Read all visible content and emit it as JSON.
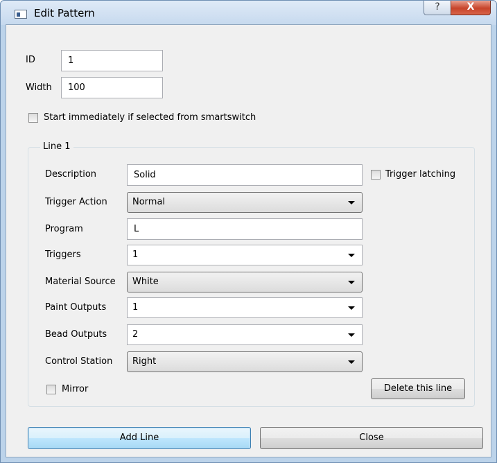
{
  "window": {
    "title": "Edit Pattern",
    "help_glyph": "?",
    "close_glyph": "X"
  },
  "form": {
    "id_label": "ID",
    "id_value": "1",
    "width_label": "Width",
    "width_value": "100",
    "start_immediately_label": "Start immediately if selected from smartswitch",
    "start_immediately_checked": false
  },
  "line_group": {
    "title": "Line 1",
    "description_label": "Description",
    "description_value": "Solid",
    "trigger_latching_label": "Trigger latching",
    "trigger_latching_checked": false,
    "trigger_action_label": "Trigger Action",
    "trigger_action_value": "Normal",
    "program_label": "Program",
    "program_value": "L",
    "triggers_label": "Triggers",
    "triggers_value": "1",
    "material_source_label": "Material Source",
    "material_source_value": "White",
    "paint_outputs_label": "Paint Outputs",
    "paint_outputs_value": "1",
    "bead_outputs_label": "Bead Outputs",
    "bead_outputs_value": "2",
    "control_station_label": "Control Station",
    "control_station_value": "Right",
    "mirror_label": "Mirror",
    "mirror_checked": false,
    "delete_label": "Delete this line"
  },
  "buttons": {
    "add_line": "Add Line",
    "close": "Close"
  },
  "icons": {
    "app": "window-icon",
    "help": "question-icon",
    "close": "close-icon",
    "dropdown": "chevron-down-icon"
  }
}
